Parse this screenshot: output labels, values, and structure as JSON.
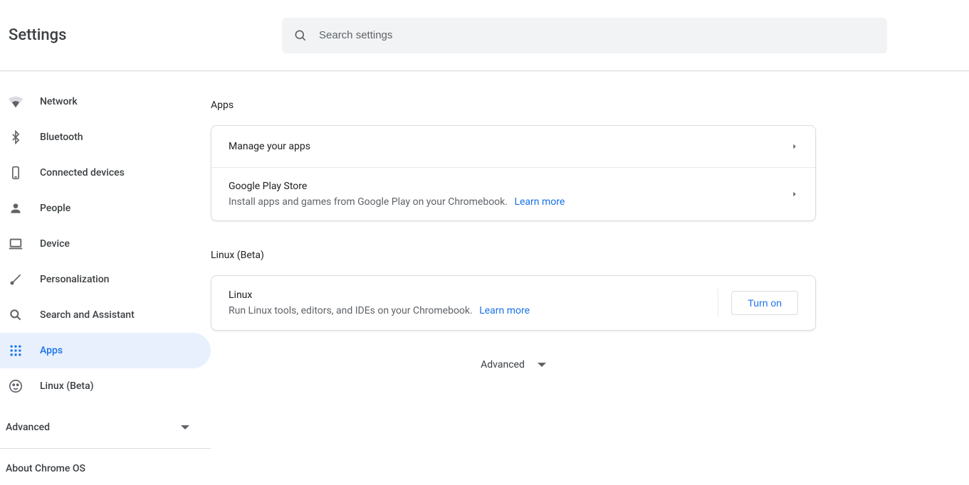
{
  "header": {
    "title": "Settings"
  },
  "search": {
    "placeholder": "Search settings"
  },
  "sidebar": {
    "items": [
      {
        "label": "Network",
        "icon": "wifi"
      },
      {
        "label": "Bluetooth",
        "icon": "bluetooth"
      },
      {
        "label": "Connected devices",
        "icon": "phone"
      },
      {
        "label": "People",
        "icon": "person"
      },
      {
        "label": "Device",
        "icon": "laptop"
      },
      {
        "label": "Personalization",
        "icon": "brush"
      },
      {
        "label": "Search and Assistant",
        "icon": "search"
      },
      {
        "label": "Apps",
        "icon": "apps"
      },
      {
        "label": "Linux (Beta)",
        "icon": "penguin"
      }
    ],
    "advanced_label": "Advanced",
    "about_label": "About Chrome OS"
  },
  "sections": {
    "apps": {
      "title": "Apps",
      "rows": [
        {
          "title": "Manage your apps"
        },
        {
          "title": "Google Play Store",
          "subtitle": "Install apps and games from Google Play on your Chromebook.",
          "learn_more": "Learn more"
        }
      ]
    },
    "linux": {
      "title": "Linux (Beta)",
      "row": {
        "title": "Linux",
        "subtitle": "Run Linux tools, editors, and IDEs on your Chromebook.",
        "learn_more": "Learn more",
        "button": "Turn on"
      }
    }
  },
  "main_advanced_label": "Advanced"
}
